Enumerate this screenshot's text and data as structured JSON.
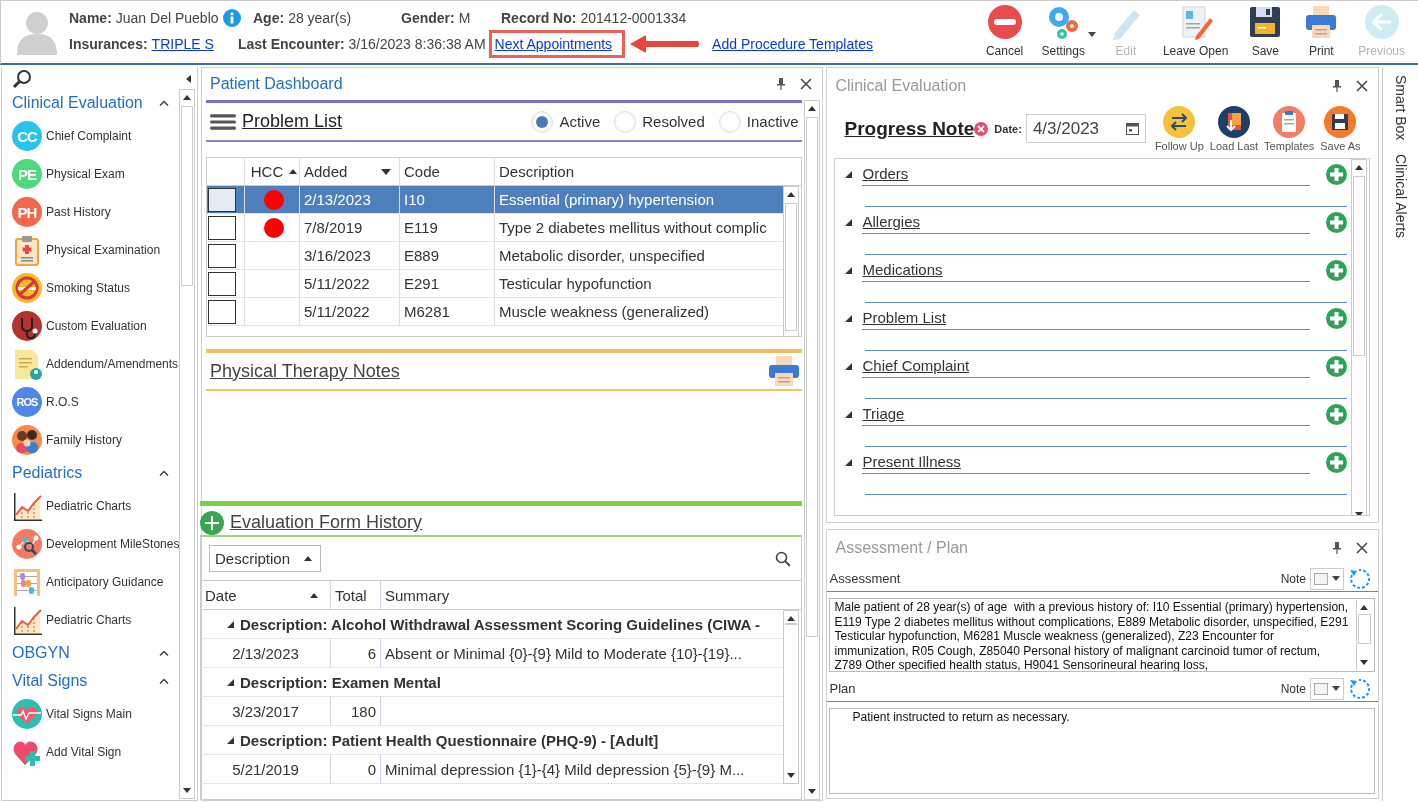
{
  "patient": {
    "name_label": "Name:",
    "name": "Juan Del Pueblo",
    "age_label": "Age:",
    "age": "28 year(s)",
    "gender_label": "Gender:",
    "gender": "M",
    "record_label": "Record No:",
    "record": "201412-0001334",
    "insurances_label": "Insurances:",
    "insurance": "TRIPLE S",
    "last_encounter_label": "Last Encounter:",
    "last_encounter": "3/16/2023 8:36:38 AM"
  },
  "header_links": [
    {
      "label": "Next Appointments",
      "highlighted": true
    },
    {
      "label": "Add Procedure Templates",
      "highlighted": false
    }
  ],
  "toolbar": [
    {
      "label": "Cancel",
      "kind": "cancel",
      "disabled": false,
      "has_menu": false
    },
    {
      "label": "Settings",
      "kind": "settings",
      "disabled": false,
      "has_menu": true
    },
    {
      "label": "Edit",
      "kind": "edit",
      "disabled": true,
      "has_menu": false
    },
    {
      "label": "Leave Open",
      "kind": "leave-open",
      "disabled": false,
      "has_menu": false
    },
    {
      "label": "Save",
      "kind": "save",
      "disabled": false,
      "has_menu": false
    },
    {
      "label": "Print",
      "kind": "print",
      "disabled": false,
      "has_menu": false
    },
    {
      "label": "Previous",
      "kind": "previous",
      "disabled": true,
      "has_menu": false
    }
  ],
  "sidebar": {
    "sections": [
      {
        "title": "Clinical Evaluation",
        "expanded": true,
        "items": [
          {
            "label": "Chief Complaint",
            "kind": "badge",
            "badge": "CC",
            "color": "#29c4ec"
          },
          {
            "label": "Physical Exam",
            "kind": "badge",
            "badge": "PE",
            "color": "#4fd97f"
          },
          {
            "label": "Past History",
            "kind": "badge",
            "badge": "PH",
            "color": "#f2674e"
          },
          {
            "label": "Physical Examination",
            "kind": "clipboard"
          },
          {
            "label": "Smoking Status",
            "kind": "smoking"
          },
          {
            "label": "Custom Evaluation",
            "kind": "stethoscope"
          },
          {
            "label": "Addendum/Amendments",
            "kind": "document"
          },
          {
            "label": "R.O.S",
            "kind": "badge",
            "badge": "ROS",
            "color": "#4f86e8"
          },
          {
            "label": "Family History",
            "kind": "family"
          }
        ]
      },
      {
        "title": "Pediatrics",
        "expanded": true,
        "items": [
          {
            "label": "Pediatric Charts",
            "kind": "chart"
          },
          {
            "label": "Development MileStones",
            "kind": "network"
          },
          {
            "label": "Anticipatory Guidance",
            "kind": "abacus"
          },
          {
            "label": "Pediatric Charts",
            "kind": "chart"
          }
        ]
      },
      {
        "title": "OBGYN",
        "expanded": true
      },
      {
        "title": "Vital Signs",
        "expanded": true,
        "items": [
          {
            "label": "Vital Signs Main",
            "kind": "heart-wave"
          },
          {
            "label": "Add Vital Sign",
            "kind": "heart-plus"
          }
        ]
      }
    ]
  },
  "patient_dashboard": {
    "title": "Patient Dashboard",
    "problem_list": {
      "title": "Problem List",
      "filters": [
        {
          "label": "Active",
          "selected": true
        },
        {
          "label": "Resolved",
          "selected": false
        },
        {
          "label": "Inactive",
          "selected": false
        }
      ],
      "columns": [
        {
          "label": "HCC",
          "sorted": true,
          "has_menu": false
        },
        {
          "label": "Added",
          "sorted": false,
          "has_menu": true
        },
        {
          "label": "Code",
          "sorted": false,
          "has_menu": false
        },
        {
          "label": "Description",
          "sorted": false,
          "has_menu": false
        }
      ],
      "rows": [
        {
          "selected": true,
          "checked": false,
          "hcc": true,
          "added": "2/13/2023",
          "code": "I10",
          "description": "Essential (primary) hypertension"
        },
        {
          "selected": false,
          "checked": false,
          "hcc": true,
          "added": "7/8/2019",
          "code": "E119",
          "description": "Type 2 diabetes mellitus without complic"
        },
        {
          "selected": false,
          "checked": false,
          "hcc": false,
          "added": "3/16/2023",
          "code": "E889",
          "description": "Metabolic disorder, unspecified"
        },
        {
          "selected": false,
          "checked": false,
          "hcc": false,
          "added": "5/11/2022",
          "code": "E291",
          "description": "Testicular hypofunction"
        },
        {
          "selected": false,
          "checked": false,
          "hcc": false,
          "added": "5/11/2022",
          "code": "M6281",
          "description": "Muscle weakness (generalized)"
        }
      ]
    },
    "physical_therapy": {
      "title": "Physical Therapy Notes"
    },
    "evaluation_history": {
      "title": "Evaluation Form History",
      "group_by": "Description",
      "columns": [
        {
          "label": "Date",
          "sorted": true
        },
        {
          "label": "Total",
          "sorted": false
        },
        {
          "label": "Summary",
          "sorted": false
        }
      ],
      "groups": [
        {
          "title": "Description: Alcohol Withdrawal Assessment Scoring Guidelines (CIWA -",
          "expanded": true,
          "rows": [
            {
              "date": "2/13/2023",
              "total": "6",
              "summary": "Absent or Minimal {0}-{9}  Mild to Moderate {10}-{19}..."
            }
          ]
        },
        {
          "title": "Description: Examen Mental",
          "expanded": true,
          "rows": [
            {
              "date": "3/23/2017",
              "total": "180"
            }
          ]
        },
        {
          "title": "Description: Patient Health Questionnaire (PHQ-9) - [Adult]",
          "expanded": true,
          "rows": [
            {
              "date": "5/21/2019",
              "total": "0",
              "summary": "Minimal depression {1}-{4}  Mild depression {5}-{9}  M..."
            }
          ]
        }
      ]
    }
  },
  "clinical_evaluation": {
    "title": "Clinical Evaluation",
    "note_title": "Progress Note",
    "date_label": "Date:",
    "date": "4/3/2023",
    "actions": [
      {
        "label": "Follow Up",
        "kind": "follow-up"
      },
      {
        "label": "Load Last",
        "kind": "load-last"
      },
      {
        "label": "Templates",
        "kind": "templates"
      },
      {
        "label": "Save As",
        "kind": "save-as"
      }
    ],
    "sections": [
      {
        "label": "Orders",
        "expanded": true
      },
      {
        "label": "Allergies",
        "expanded": true
      },
      {
        "label": "Medications",
        "expanded": true
      },
      {
        "label": "Problem List",
        "expanded": true
      },
      {
        "label": "Chief Complaint",
        "expanded": true
      },
      {
        "label": "Triage",
        "expanded": true
      },
      {
        "label": "Present Illness",
        "expanded": true
      }
    ]
  },
  "assessment_plan": {
    "title": "Assessment / Plan",
    "fields": [
      {
        "label": "Assessment",
        "note_label": "Note",
        "text": "Male patient of 28 year(s) of age  with a previous history of: I10 Essential (primary) hypertension, E119 Type 2 diabetes mellitus without complications, E889 Metabolic disorder, unspecified, E291 Testicular hypofunction, M6281 Muscle weakness (generalized), Z23 Encounter for immunization, R05 Cough, Z85040 Personal history of malignant carcinoid tumor of rectum, Z789 Other specified health status, H9041 Sensorineural hearing loss,",
        "scrollable": true
      },
      {
        "label": "Plan",
        "note_label": "Note",
        "text": "Patient instructed to return as necessary.",
        "scrollable": false
      }
    ]
  },
  "side_tabs": [
    {
      "label": "Smart Box"
    },
    {
      "label": "Clinical Alerts"
    }
  ]
}
